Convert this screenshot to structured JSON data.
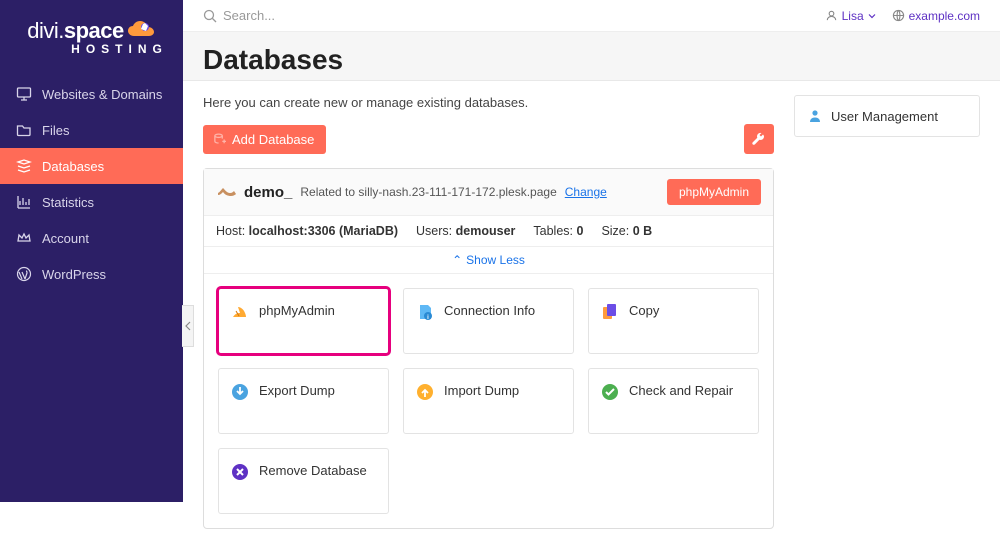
{
  "brand": {
    "part1": "divi.",
    "part2": "space",
    "sub": "HOSTING"
  },
  "nav": [
    {
      "label": "Websites & Domains",
      "icon": "monitor"
    },
    {
      "label": "Files",
      "icon": "folder"
    },
    {
      "label": "Databases",
      "icon": "stack",
      "active": true
    },
    {
      "label": "Statistics",
      "icon": "chart"
    },
    {
      "label": "Account",
      "icon": "crown"
    },
    {
      "label": "WordPress",
      "icon": "wordpress"
    }
  ],
  "search": {
    "placeholder": "Search..."
  },
  "user": {
    "name": "Lisa"
  },
  "domain": {
    "label": "example.com"
  },
  "page": {
    "title": "Databases",
    "intro": "Here you can create new or manage existing databases."
  },
  "actions": {
    "add": "Add Database"
  },
  "db": {
    "name": "demo_",
    "related_prefix": "Related to ",
    "related_domain": "silly-nash.23-111-171-172.plesk.page",
    "change": "Change",
    "pma_btn": "phpMyAdmin",
    "host_label": "Host:",
    "host_value": "localhost:3306 (MariaDB)",
    "users_label": "Users:",
    "users_value": "demouser",
    "tables_label": "Tables:",
    "tables_value": "0",
    "size_label": "Size:",
    "size_value": "0 B",
    "showless": "Show Less"
  },
  "tiles": [
    {
      "label": "phpMyAdmin",
      "icon": "pma",
      "highlight": true
    },
    {
      "label": "Connection Info",
      "icon": "info"
    },
    {
      "label": "Copy",
      "icon": "copy"
    },
    {
      "label": "Export Dump",
      "icon": "export"
    },
    {
      "label": "Import Dump",
      "icon": "import"
    },
    {
      "label": "Check and Repair",
      "icon": "check"
    },
    {
      "label": "Remove Database",
      "icon": "remove"
    }
  ],
  "side": {
    "user_mgmt": "User Management"
  }
}
